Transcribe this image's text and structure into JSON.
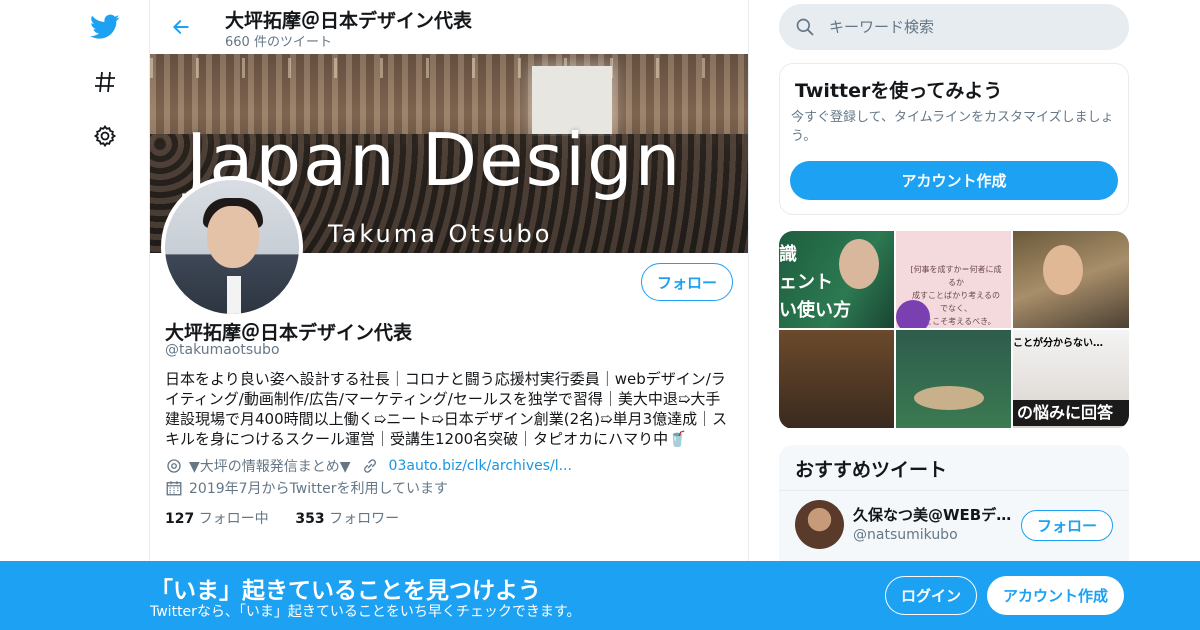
{
  "header": {
    "title": "大坪拓摩＠日本デザイン代表",
    "tweet_count": "660 件のツイート"
  },
  "banner": {
    "title": "Japan Design",
    "subtitle": "Takuma Otsubo"
  },
  "profile": {
    "name": "大坪拓摩＠日本デザイン代表",
    "handle": "@takumaotsubo",
    "follow_label": "フォロー",
    "bio": "日本をより良い姿へ設計する社長｜コロナと闘う応援村実行委員｜webデザイン/ライティング/動画制作/広告/マーケティング/セールスを独学で習得｜美大中退➯大手建設現場で月400時間以上働く➯ニート➯日本デザイン創業(2名)➯単月3億達成｜スキルを身につけるスクール運営｜受講生1200名突破｜タピオカにハマり中🥤",
    "location": "▼大坪の情報発信まとめ▼",
    "link": "03auto.biz/clk/archives/l...",
    "joined": "2019年7月からTwitterを利用しています",
    "following_count": "127",
    "following_label": "フォロー中",
    "followers_count": "353",
    "followers_label": "フォロワー"
  },
  "search": {
    "placeholder": "キーワード検索"
  },
  "signup_card": {
    "title": "Twitterを使ってみよう",
    "description": "今すぐ登録して、タイムラインをカスタマイズしましょう。",
    "button": "アカウント作成"
  },
  "media": {
    "tile1_text": "識\nェント\nい使い方",
    "tile2_text": "[何事を成すか＝何者に成るか\n成すことばかり考えるのでなく、\nことこそ考えるべき。",
    "tile6_top": "ことが分からない…",
    "tile6_bottom": "の悩みに回答"
  },
  "recommended": {
    "title": "おすすめツイート",
    "user_name": "久保なつ美@WEBデザイナー",
    "user_handle": "@natsumikubo",
    "follow_label": "フォロー"
  },
  "bottom_bar": {
    "title": "「いま」起きていることを見つけよう",
    "subtitle": "Twitterなら、「いま」起きていることをいち早くチェックできます。",
    "login": "ログイン",
    "signup": "アカウント作成"
  },
  "colors": {
    "accent": "#1da1f2",
    "secondary_text": "#657786",
    "link": "#1b95e0"
  },
  "icons": [
    "twitter-bird-icon",
    "hashtag-icon",
    "gear-icon",
    "back-arrow-icon",
    "search-icon",
    "location-icon",
    "link-icon",
    "calendar-icon"
  ]
}
